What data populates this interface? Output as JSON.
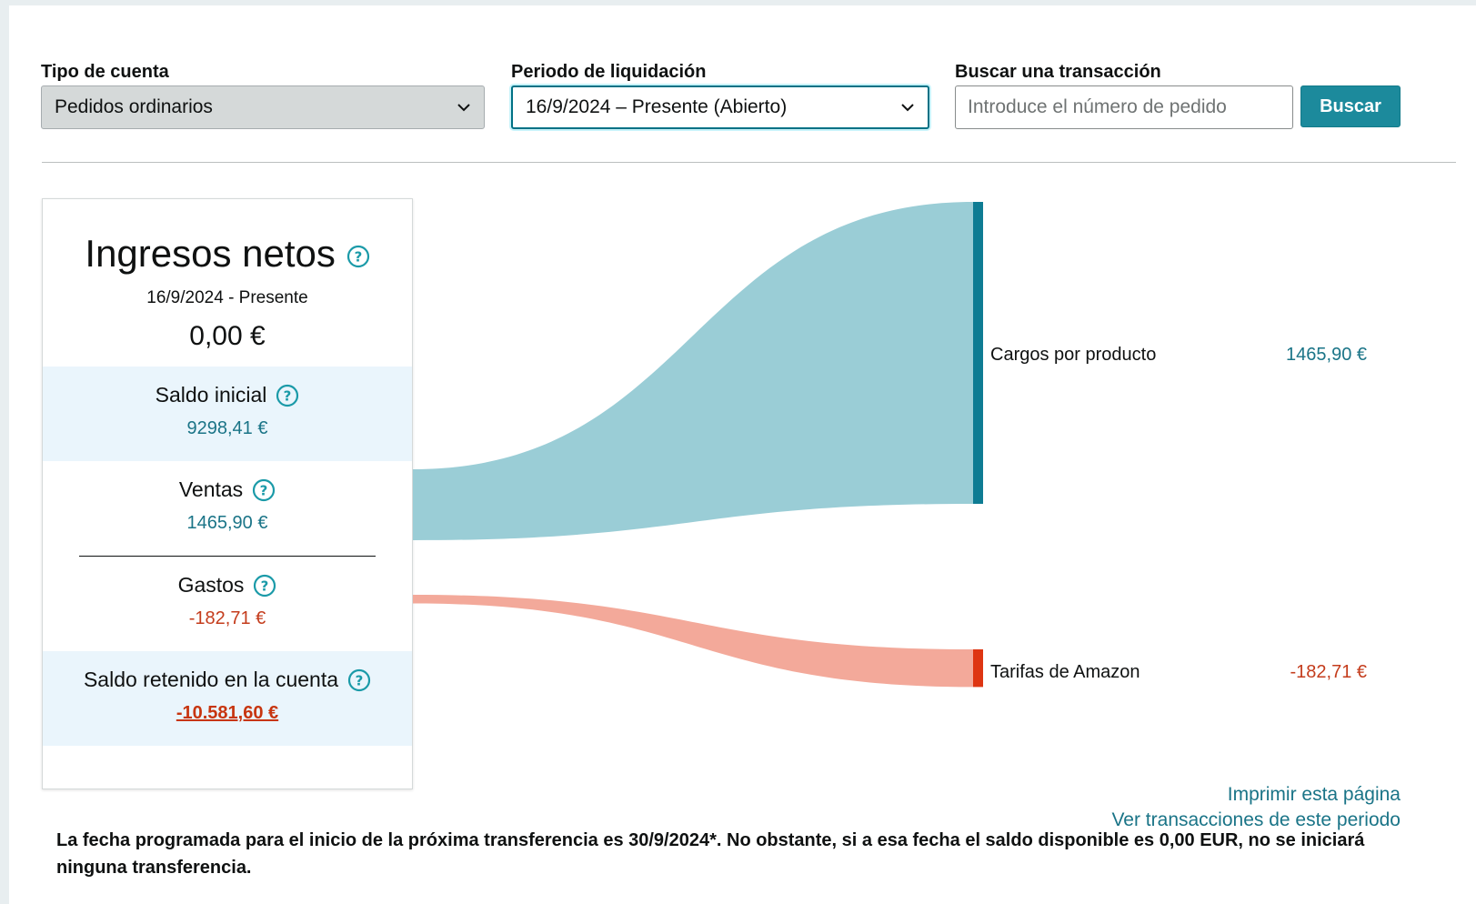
{
  "filters": {
    "account_type": {
      "label": "Tipo de cuenta",
      "value": "Pedidos ordinarios"
    },
    "settlement_period": {
      "label": "Periodo de liquidación",
      "value": "16/9/2024 – Presente (Abierto)"
    },
    "search": {
      "label": "Buscar una transacción",
      "placeholder": "Introduce el número de pedido",
      "button": "Buscar"
    }
  },
  "summary": {
    "title": "Ingresos netos",
    "date_range": "16/9/2024 - Presente",
    "total": "0,00 €",
    "opening_balance": {
      "label": "Saldo inicial",
      "value": "9298,41 €"
    },
    "sales": {
      "label": "Ventas",
      "value": "1465,90 €"
    },
    "expenses": {
      "label": "Gastos",
      "value": "-182,71 €"
    },
    "held_balance": {
      "label": "Saldo retenido en la cuenta",
      "value": "-10.581,60 €"
    }
  },
  "chart_data": {
    "type": "sankey",
    "nodes": [
      {
        "name": "Cargos por producto",
        "value": "1465,90 €",
        "amount": 1465.9,
        "color": "#0e7c93"
      },
      {
        "name": "Tarifas de Amazon",
        "value": "-182,71 €",
        "amount": -182.71,
        "color": "#de3512"
      }
    ],
    "link_colors": {
      "positive": "#9acdd6",
      "negative": "#f3a99a"
    }
  },
  "links": {
    "print": "Imprimir esta página",
    "view_transactions": "Ver transacciones de este periodo"
  },
  "notice": "La fecha programada para el inicio de la próxima transferencia es 30/9/2024*. No obstante, si a esa fecha el saldo disponible es 0,00 EUR, no se iniciará ninguna transferencia.",
  "colors": {
    "accent": "#1a7487",
    "negative": "#c43c1c",
    "button": "#1c8a9c"
  }
}
